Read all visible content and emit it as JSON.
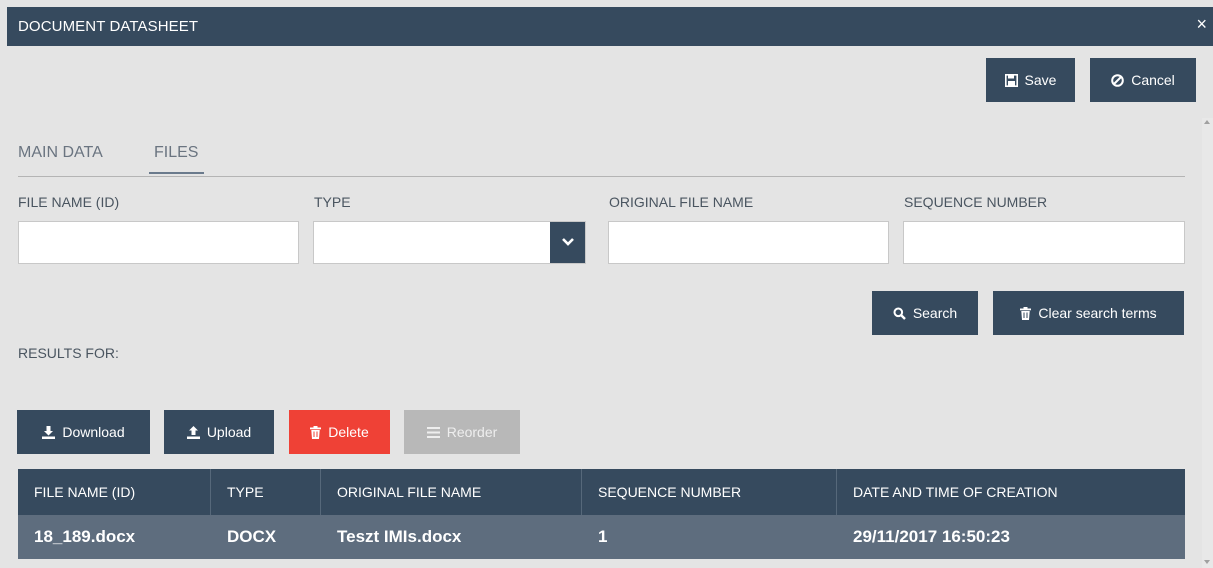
{
  "window": {
    "title": "DOCUMENT DATASHEET",
    "close_glyph": "×"
  },
  "toolbar": {
    "save_label": "Save",
    "cancel_label": "Cancel"
  },
  "tabs": [
    {
      "label": "MAIN DATA",
      "active": false
    },
    {
      "label": "FILES",
      "active": true
    }
  ],
  "filters": {
    "file_name": {
      "label": "FILE NAME (ID)",
      "value": "",
      "placeholder": ""
    },
    "type": {
      "label": "TYPE",
      "value": "",
      "placeholder": ""
    },
    "original_file_name": {
      "label": "ORIGINAL FILE NAME",
      "value": "",
      "placeholder": ""
    },
    "sequence_number": {
      "label": "SEQUENCE NUMBER",
      "value": "",
      "placeholder": ""
    }
  },
  "search_buttons": {
    "search_label": "Search",
    "clear_label": "Clear search terms"
  },
  "results": {
    "label": "RESULTS FOR:"
  },
  "actions": {
    "download_label": "Download",
    "upload_label": "Upload",
    "delete_label": "Delete",
    "reorder_label": "Reorder"
  },
  "table": {
    "headers": [
      "FILE NAME (ID)",
      "TYPE",
      "ORIGINAL FILE NAME",
      "SEQUENCE NUMBER",
      "DATE AND TIME OF CREATION"
    ],
    "rows": [
      [
        "18_189.docx",
        "DOCX",
        "Teszt IMIs.docx",
        "1",
        "29/11/2017 16:50:23"
      ]
    ]
  },
  "colors": {
    "primary": "#364a5e",
    "danger": "#ef4136",
    "disabled": "#b8b8b8",
    "row_bg": "#5e6d7e",
    "background": "#e4e4e4"
  },
  "icons": {
    "save": "floppy-disk-icon",
    "cancel": "ban-icon",
    "search": "magnifier-icon",
    "clear": "trash-icon",
    "download": "download-icon",
    "upload": "upload-icon",
    "delete": "trash-icon",
    "reorder": "bars-icon",
    "select": "chevron-down-icon"
  }
}
